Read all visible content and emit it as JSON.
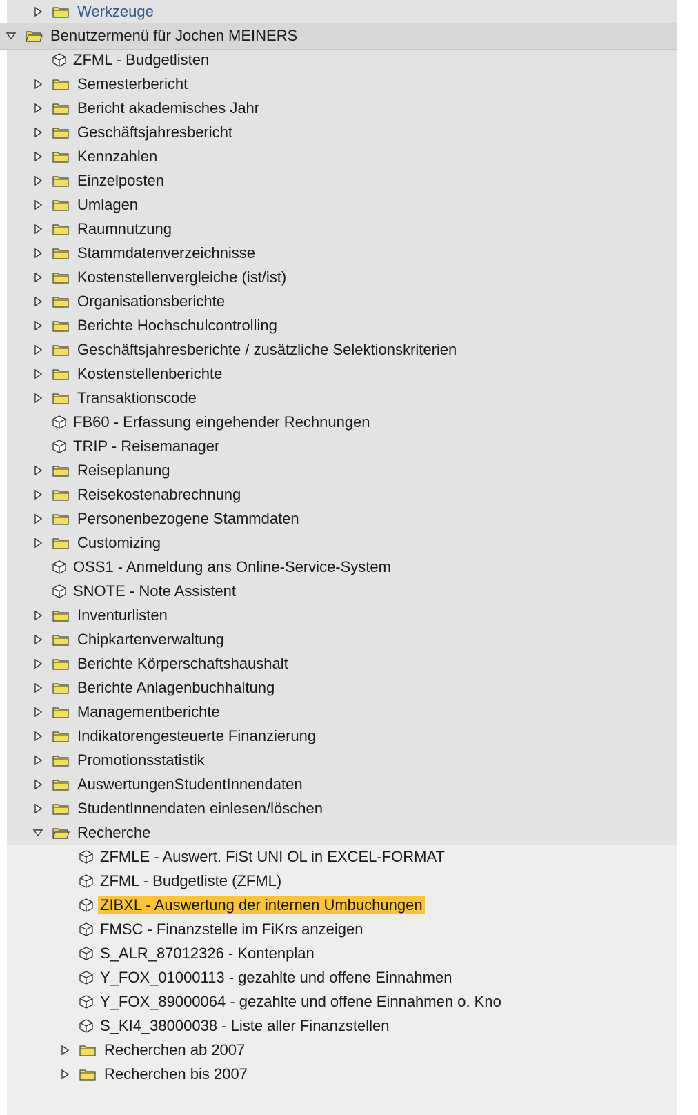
{
  "tree": {
    "top_item": {
      "label": "Werkzeuge",
      "kind": "folder",
      "expanded": false
    },
    "root": {
      "label": "Benutzermenü für Jochen MEINERS",
      "kind": "folder",
      "expanded": true
    },
    "level1": [
      {
        "label": "ZFML - Budgetlisten",
        "kind": "transaction"
      },
      {
        "label": "Semesterbericht",
        "kind": "folder",
        "expanded": false
      },
      {
        "label": "Bericht akademisches Jahr",
        "kind": "folder",
        "expanded": false
      },
      {
        "label": "Geschäftsjahresbericht",
        "kind": "folder",
        "expanded": false
      },
      {
        "label": "Kennzahlen",
        "kind": "folder",
        "expanded": false
      },
      {
        "label": "Einzelposten",
        "kind": "folder",
        "expanded": false
      },
      {
        "label": "Umlagen",
        "kind": "folder",
        "expanded": false
      },
      {
        "label": "Raumnutzung",
        "kind": "folder",
        "expanded": false
      },
      {
        "label": "Stammdatenverzeichnisse",
        "kind": "folder",
        "expanded": false
      },
      {
        "label": "Kostenstellenvergleiche (ist/ist)",
        "kind": "folder",
        "expanded": false
      },
      {
        "label": "Organisationsberichte",
        "kind": "folder",
        "expanded": false
      },
      {
        "label": "Berichte Hochschulcontrolling",
        "kind": "folder",
        "expanded": false
      },
      {
        "label": "Geschäftsjahresberichte / zusätzliche Selektionskriterien",
        "kind": "folder",
        "expanded": false
      },
      {
        "label": "Kostenstellenberichte",
        "kind": "folder",
        "expanded": false
      },
      {
        "label": "Transaktionscode",
        "kind": "folder",
        "expanded": false
      },
      {
        "label": "FB60 - Erfassung eingehender Rechnungen",
        "kind": "transaction"
      },
      {
        "label": "TRIP - Reisemanager",
        "kind": "transaction"
      },
      {
        "label": "Reiseplanung",
        "kind": "folder",
        "expanded": false
      },
      {
        "label": "Reisekostenabrechnung",
        "kind": "folder",
        "expanded": false
      },
      {
        "label": "Personenbezogene Stammdaten",
        "kind": "folder",
        "expanded": false
      },
      {
        "label": "Customizing",
        "kind": "folder",
        "expanded": false
      },
      {
        "label": "OSS1 - Anmeldung ans Online-Service-System",
        "kind": "transaction"
      },
      {
        "label": "SNOTE - Note Assistent",
        "kind": "transaction"
      },
      {
        "label": "Inventurlisten",
        "kind": "folder",
        "expanded": false
      },
      {
        "label": "Chipkartenverwaltung",
        "kind": "folder",
        "expanded": false
      },
      {
        "label": "Berichte Körperschaftshaushalt",
        "kind": "folder",
        "expanded": false
      },
      {
        "label": "Berichte Anlagenbuchhaltung",
        "kind": "folder",
        "expanded": false
      },
      {
        "label": "Managementberichte",
        "kind": "folder",
        "expanded": false
      },
      {
        "label": "Indikatorengesteuerte Finanzierung",
        "kind": "folder",
        "expanded": false
      },
      {
        "label": "Promotionsstatistik",
        "kind": "folder",
        "expanded": false
      },
      {
        "label": "AuswertungenStudentInnendaten",
        "kind": "folder",
        "expanded": false
      },
      {
        "label": "StudentInnendaten einlesen/löschen",
        "kind": "folder",
        "expanded": false
      },
      {
        "label": "Recherche",
        "kind": "folder",
        "expanded": true
      }
    ],
    "recherche_children": [
      {
        "label": "ZFMLE - Auswert. FiSt UNI OL in EXCEL-FORMAT",
        "kind": "transaction"
      },
      {
        "label": "ZFML - Budgetliste (ZFML)",
        "kind": "transaction"
      },
      {
        "label": "ZIBXL - Auswertung der internen Umbuchungen",
        "kind": "transaction",
        "selected": true
      },
      {
        "label": "FMSC - Finanzstelle im FiKrs anzeigen",
        "kind": "transaction"
      },
      {
        "label": "S_ALR_87012326 - Kontenplan",
        "kind": "transaction"
      },
      {
        "label": "Y_FOX_01000113 - gezahlte und offene Einnahmen",
        "kind": "transaction"
      },
      {
        "label": "Y_FOX_89000064 - gezahlte und offene Einnahmen o. Kno",
        "kind": "transaction"
      },
      {
        "label": "S_KI4_38000038 - Liste aller Finanzstellen",
        "kind": "transaction"
      },
      {
        "label": "Recherchen ab 2007",
        "kind": "folder",
        "expanded": false
      },
      {
        "label": "Recherchen bis 2007",
        "kind": "folder",
        "expanded": false
      }
    ],
    "colors": {
      "selection": "#fdc33a",
      "folder": "#f1e15a",
      "band": "#e4e3e3",
      "link": "#2f5a8f"
    }
  }
}
